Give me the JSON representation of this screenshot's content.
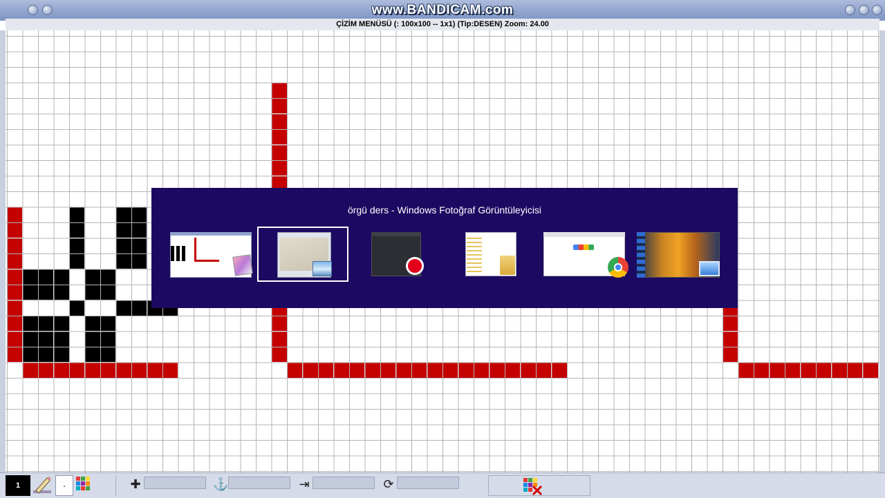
{
  "window": {
    "watermark": "www.BANDICAM.com",
    "subtitle": "ÇİZİM MENÜSÜ   (: 100x100 -- 1x1) (Tip:DESEN) Zoom: 24.00"
  },
  "colors": {
    "red_cell": "#c40000",
    "black_cell": "#000000",
    "grid_line": "#b4b4b4",
    "switcher_bg": "#1c0a62",
    "title_bar": "#8ea2cc"
  },
  "task_switcher": {
    "title": "örgü ders - Windows Fotoğraf Görüntüleyicisi",
    "apps": [
      {
        "name": "pattern-editor-app",
        "selected": false
      },
      {
        "name": "windows-photo-viewer",
        "selected": true
      },
      {
        "name": "bandicam-recorder",
        "selected": false
      },
      {
        "name": "file-explorer",
        "selected": false
      },
      {
        "name": "google-chrome",
        "selected": false
      },
      {
        "name": "desktop",
        "selected": false
      }
    ]
  },
  "toolbar": {
    "layer_number": "1",
    "dot_label": "·",
    "icons": [
      "pencil-icon",
      "color-grid-icon",
      "plus-icon",
      "anchor-icon",
      "move-icon",
      "rotate-icon",
      "clear-grid-icon"
    ]
  }
}
